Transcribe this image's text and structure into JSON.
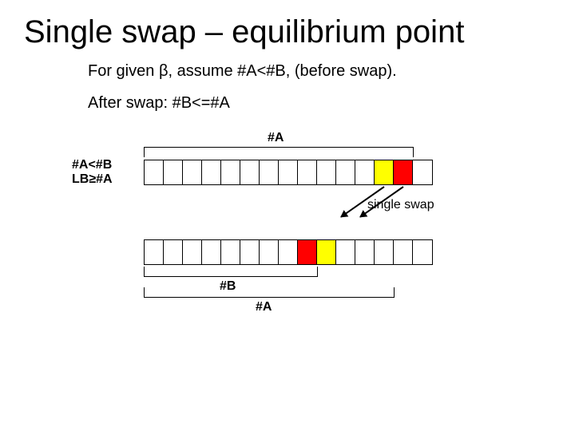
{
  "title": "Single swap – equilibrium point",
  "line1_prefix": "For given ",
  "beta": "β",
  "line1_suffix": ", assume #A<#B, (before swap).",
  "line2": "After swap: #B<=#A",
  "labels": {
    "top_A": "#A",
    "left1": "#A<#B",
    "left2": "LB≥#A",
    "single_swap": "single swap",
    "bot_B": "#B",
    "bot_A": "#A"
  },
  "diagram": {
    "cells_per_row": 15,
    "top_row": {
      "yellow_index": 12,
      "red_index": 13,
      "bracket_A_span": [
        0,
        13
      ]
    },
    "bottom_row": {
      "red_index": 8,
      "yellow_index": 9,
      "bracket_B_span": [
        0,
        8
      ],
      "bracket_A_span": [
        0,
        12
      ]
    }
  }
}
